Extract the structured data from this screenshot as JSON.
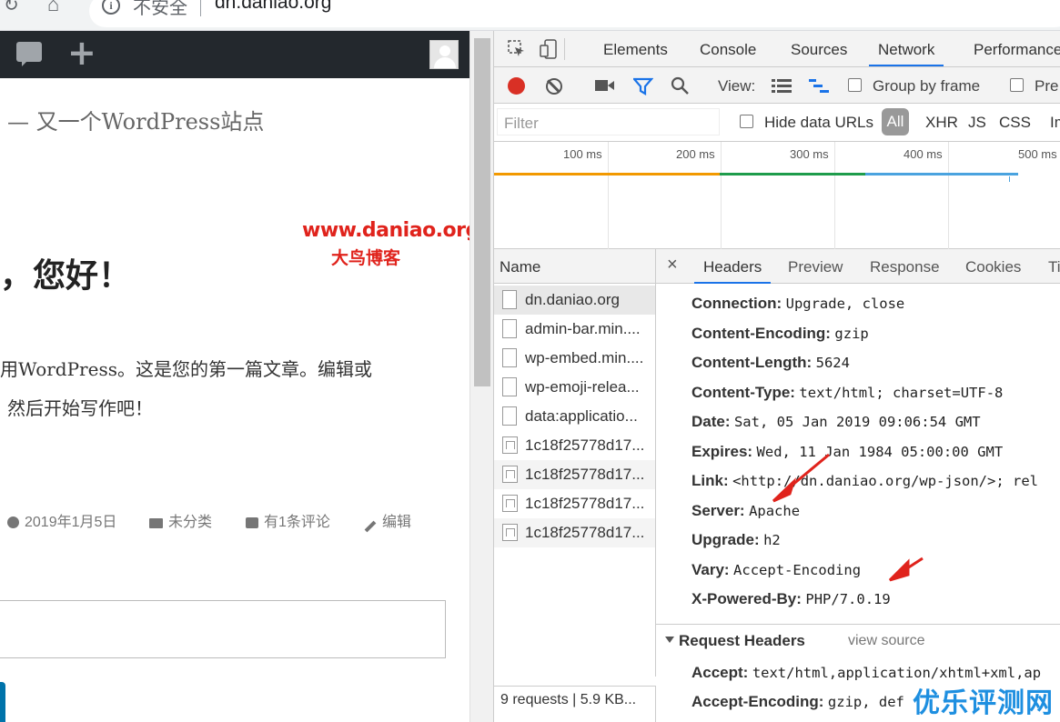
{
  "browser": {
    "reload_icon": "reload-icon",
    "home_icon": "home-icon",
    "info_icon": "info-icon",
    "security_label": "不安全",
    "url": "dn.daniao.org"
  },
  "page": {
    "tagline": "— 又一个WordPress站点",
    "watermark_url": "www.daniao.org",
    "watermark_name": "大鸟博客",
    "greeting": "，您好！",
    "body_line1": "用WordPress。这是您的第一篇文章。编辑或",
    "body_line2": "然后开始写作吧！",
    "meta": {
      "date": "2019年1月5日",
      "category": "未分类",
      "comments": "有1条评论",
      "edit": "编辑"
    }
  },
  "devtools": {
    "tabs": [
      "Elements",
      "Console",
      "Sources",
      "Network",
      "Performance"
    ],
    "active_tab": "Network",
    "toolbar": {
      "view_label": "View:",
      "group_by_frame": "Group by frame",
      "preserve_log": "Pre"
    },
    "filter": {
      "placeholder": "Filter",
      "hide_data_urls": "Hide data URLs",
      "types": [
        "All",
        "XHR",
        "JS",
        "CSS",
        "Img"
      ]
    },
    "timeline_ticks": [
      "100 ms",
      "200 ms",
      "300 ms",
      "400 ms",
      "500 ms"
    ],
    "name_header": "Name",
    "requests": [
      "dn.daniao.org",
      "admin-bar.min....",
      "wp-embed.min....",
      "wp-emoji-relea...",
      "data:applicatio...",
      "1c18f25778d17...",
      "1c18f25778d17...",
      "1c18f25778d17...",
      "1c18f25778d17..."
    ],
    "status": "9 requests | 5.9 KB...",
    "detail_tabs": [
      "Headers",
      "Preview",
      "Response",
      "Cookies",
      "Ti"
    ],
    "response_headers": [
      {
        "key": "Connection:",
        "value": "Upgrade, close"
      },
      {
        "key": "Content-Encoding:",
        "value": "gzip"
      },
      {
        "key": "Content-Length:",
        "value": "5624"
      },
      {
        "key": "Content-Type:",
        "value": "text/html; charset=UTF-8"
      },
      {
        "key": "Date:",
        "value": "Sat, 05 Jan 2019 09:06:54 GMT"
      },
      {
        "key": "Expires:",
        "value": "Wed, 11 Jan 1984 05:00:00 GMT"
      },
      {
        "key": "Link:",
        "value": "<http://dn.daniao.org/wp-json/>; rel"
      },
      {
        "key": "Server:",
        "value": "Apache"
      },
      {
        "key": "Upgrade:",
        "value": "h2"
      },
      {
        "key": "Vary:",
        "value": "Accept-Encoding"
      },
      {
        "key": "X-Powered-By:",
        "value": "PHP/7.0.19"
      }
    ],
    "request_headers_title": "Request Headers",
    "view_source": "view source",
    "request_headers": [
      {
        "key": "Accept:",
        "value": "text/html,application/xhtml+xml,ap"
      },
      {
        "key": "Accept-Encoding:",
        "value": "gzip, def"
      }
    ]
  },
  "overlay": {
    "brand": "优乐评测网"
  },
  "colors": {
    "record": "#d93025",
    "accent": "#1a73e8",
    "watermark": "#e0231c",
    "brand": "#1e8fe0",
    "arrow": "#e0231c"
  }
}
